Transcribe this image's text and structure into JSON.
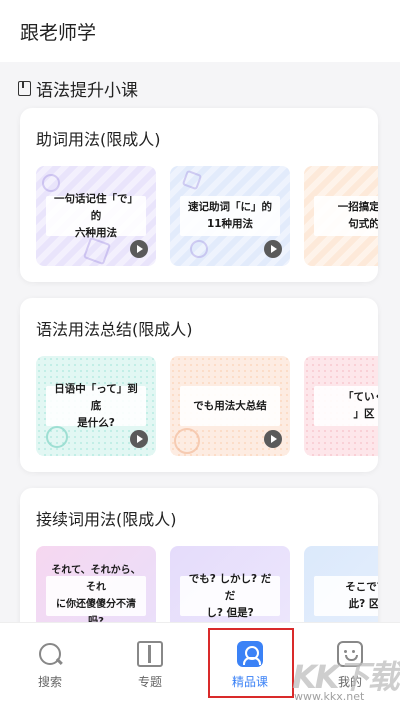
{
  "header": {
    "title": "跟老师学"
  },
  "section": {
    "title": "语法提升小课"
  },
  "cards": [
    {
      "title": "助词用法(限成人)",
      "thumbs": [
        "一句话记住「で」的\n六种用法",
        "速记助词「に」的\n11种用法",
        "一招搞定「\n句式的"
      ]
    },
    {
      "title": "语法用法总结(限成人)",
      "thumbs": [
        "日语中「って」到底\n是什么?",
        "でも用法大总结",
        "「ていく\n」区"
      ]
    },
    {
      "title": "接续词用法(限成人)",
      "thumbs": [
        "それて、それから、それ\nに你还傻傻分不清吗?",
        "でも? しかし? だだ\nし? 但是?",
        "そこで? \n此? 区"
      ]
    }
  ],
  "tabs": [
    {
      "label": "搜索",
      "icon": "search-icon"
    },
    {
      "label": "专题",
      "icon": "map-icon"
    },
    {
      "label": "精品课",
      "icon": "course-icon"
    },
    {
      "label": "我的",
      "icon": "profile-icon"
    }
  ],
  "watermark": {
    "big": "KK下载",
    "small": "www.kkx.net"
  },
  "colors": {
    "accent": "#3b82f6",
    "highlight": "#d92a2a"
  }
}
